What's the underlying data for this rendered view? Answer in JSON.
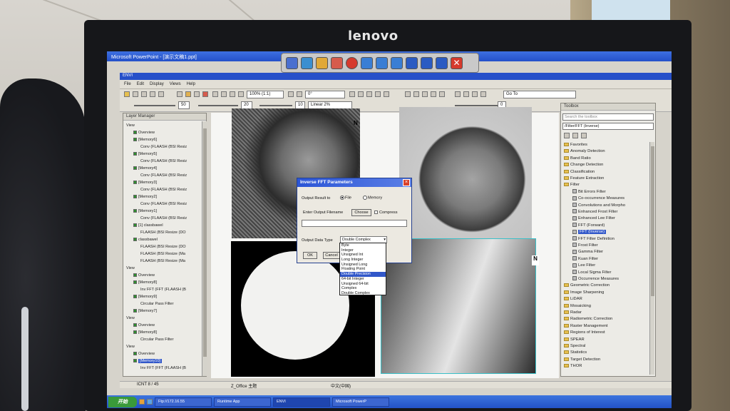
{
  "monitor": {
    "brand": "lenovo"
  },
  "powerpoint": {
    "title": "Microsoft PowerPoint - [演示文稿1.ppt]"
  },
  "envi": {
    "title": "ENVI",
    "menu": [
      "File",
      "Edit",
      "Display",
      "Views",
      "Help"
    ],
    "zoom_value": "100% (1:1)",
    "rotation_value": "0°",
    "stretch_value": "Linear 2%",
    "goto_value": "Go To",
    "brightness_value": "50",
    "contrast_value": "20",
    "sharpen_value": "10",
    "transparency_value": "0"
  },
  "layer_manager": {
    "title": "Layer Manager",
    "rows": [
      {
        "label": "View",
        "depth": 0,
        "box": false
      },
      {
        "label": "Overview",
        "depth": 1,
        "box": true
      },
      {
        "label": "[Memory6]",
        "depth": 1,
        "box": true
      },
      {
        "label": "Conv (FLAASH (BSI Resiz",
        "depth": 2,
        "box": false
      },
      {
        "label": "[Memory5]",
        "depth": 1,
        "box": true
      },
      {
        "label": "Conv (FLAASH (BSI Resiz",
        "depth": 2,
        "box": false
      },
      {
        "label": "[Memory4]",
        "depth": 1,
        "box": true
      },
      {
        "label": "Conv (FLAASH (BSI Resiz",
        "depth": 2,
        "box": false
      },
      {
        "label": "[Memory3]",
        "depth": 1,
        "box": true
      },
      {
        "label": "Conv (FLAASH (BSI Resiz",
        "depth": 2,
        "box": false
      },
      {
        "label": "[Memory2]",
        "depth": 1,
        "box": true
      },
      {
        "label": "Conv (FLAASH (BSI Resiz",
        "depth": 2,
        "box": false
      },
      {
        "label": "[Memory1]",
        "depth": 1,
        "box": true
      },
      {
        "label": "Conv (FLAASH (BSI Resiz",
        "depth": 2,
        "box": false
      },
      {
        "label": "[1] classbawel",
        "depth": 1,
        "box": true
      },
      {
        "label": "FLAASH (BSI Resize (DO",
        "depth": 2,
        "box": false
      },
      {
        "label": "classbawel",
        "depth": 1,
        "box": true
      },
      {
        "label": "FLAASH (BSI Resize (DO",
        "depth": 2,
        "box": false
      },
      {
        "label": "FLAASH (BSI Resize (Ma",
        "depth": 2,
        "box": false
      },
      {
        "label": "FLAASH (BSI Resize (Ma",
        "depth": 2,
        "box": false
      },
      {
        "label": "View",
        "depth": 0,
        "box": false
      },
      {
        "label": "Overview",
        "depth": 1,
        "box": true
      },
      {
        "label": "[Memory8]",
        "depth": 1,
        "box": true
      },
      {
        "label": "Inv FFT (FFT (FLAASH (B",
        "depth": 2,
        "box": false
      },
      {
        "label": "[Memory9]",
        "depth": 1,
        "box": true
      },
      {
        "label": "Circular Pass Filter",
        "depth": 2,
        "box": false
      },
      {
        "label": "[Memory7]",
        "depth": 1,
        "box": true
      },
      {
        "label": "View",
        "depth": 0,
        "box": false
      },
      {
        "label": "Overview",
        "depth": 1,
        "box": true
      },
      {
        "label": "[Memory8]",
        "depth": 1,
        "box": true
      },
      {
        "label": "Circular Pass Filter",
        "depth": 2,
        "box": false
      },
      {
        "label": "View",
        "depth": 0,
        "box": false
      },
      {
        "label": "Overview",
        "depth": 1,
        "box": true
      },
      {
        "label": "[Memory10]",
        "depth": 1,
        "box": true,
        "selected": true
      },
      {
        "label": "Inv FFT (FFT (FLAASH (B",
        "depth": 2,
        "box": false
      }
    ]
  },
  "toolbox": {
    "title": "Toolbox",
    "search_placeholder": "Search the toolbox",
    "path": "/Filter/FFT (Inverse)",
    "rows": [
      {
        "label": "Favorites",
        "type": "folder",
        "depth": 0
      },
      {
        "label": "Anomaly Detection",
        "type": "folder",
        "depth": 0
      },
      {
        "label": "Band Ratio",
        "type": "folder",
        "depth": 0
      },
      {
        "label": "Change Detection",
        "type": "folder",
        "depth": 0
      },
      {
        "label": "Classification",
        "type": "folder",
        "depth": 0
      },
      {
        "label": "Feature Extraction",
        "type": "folder",
        "depth": 0
      },
      {
        "label": "Filter",
        "type": "folder",
        "depth": 0
      },
      {
        "label": "Bit Errors Filter",
        "type": "tool",
        "depth": 1
      },
      {
        "label": "Co-occurrence Measures",
        "type": "tool",
        "depth": 1
      },
      {
        "label": "Convolutions and Morpho",
        "type": "tool",
        "depth": 1
      },
      {
        "label": "Enhanced Frost Filter",
        "type": "tool",
        "depth": 1
      },
      {
        "label": "Enhanced Lee Filter",
        "type": "tool",
        "depth": 1
      },
      {
        "label": "FFT (Forward)",
        "type": "tool",
        "depth": 1
      },
      {
        "label": "FFT (Inverse)",
        "type": "tool",
        "depth": 1,
        "selected": true
      },
      {
        "label": "FFT Filter Definition",
        "type": "tool",
        "depth": 1
      },
      {
        "label": "Frost Filter",
        "type": "tool",
        "depth": 1
      },
      {
        "label": "Gamma Filter",
        "type": "tool",
        "depth": 1
      },
      {
        "label": "Kuan Filter",
        "type": "tool",
        "depth": 1
      },
      {
        "label": "Lee Filter",
        "type": "tool",
        "depth": 1
      },
      {
        "label": "Local Sigma Filter",
        "type": "tool",
        "depth": 1
      },
      {
        "label": "Occurrence Measures",
        "type": "tool",
        "depth": 1
      },
      {
        "label": "Geometric Correction",
        "type": "folder",
        "depth": 0
      },
      {
        "label": "Image Sharpening",
        "type": "folder",
        "depth": 0
      },
      {
        "label": "LiDAR",
        "type": "folder",
        "depth": 0
      },
      {
        "label": "Mosaicking",
        "type": "folder",
        "depth": 0
      },
      {
        "label": "Radar",
        "type": "folder",
        "depth": 0
      },
      {
        "label": "Radiometric Correction",
        "type": "folder",
        "depth": 0
      },
      {
        "label": "Raster Management",
        "type": "folder",
        "depth": 0
      },
      {
        "label": "Regions of Interest",
        "type": "folder",
        "depth": 0
      },
      {
        "label": "SPEAR",
        "type": "folder",
        "depth": 0
      },
      {
        "label": "Spectral",
        "type": "folder",
        "depth": 0
      },
      {
        "label": "Statistics",
        "type": "folder",
        "depth": 0
      },
      {
        "label": "Target Detection",
        "type": "folder",
        "depth": 0
      },
      {
        "label": "THOR",
        "type": "folder",
        "depth": 0
      }
    ]
  },
  "dialog": {
    "title": "Inverse FFT Parameters",
    "output_result_to": "Output Result to",
    "radio_file": "File",
    "radio_memory": "Memory",
    "enter_filename": "Enter Output Filename",
    "choose_button": "Choose",
    "compress_label": "Compress",
    "data_type_label": "Output Data Type",
    "data_type_value": "Double Complex",
    "ok_button": "OK",
    "cancel_button": "Cancel",
    "data_type_options": [
      "Byte",
      "Integer",
      "Unsigned Int",
      "Long Integer",
      "Unsigned Long",
      "Floating Point",
      "Double Precision",
      "64-bit Integer",
      "Unsigned 64-bit",
      "Complex",
      "Double Complex"
    ],
    "highlighted_option": "Double Precision"
  },
  "view_labels": {
    "north_1": "N",
    "north_2": "N"
  },
  "statusbar": {
    "left": "ICNT 8 / 45",
    "middle": "Z_Office 主题",
    "ime": "中文(中国)"
  },
  "taskbar": {
    "start": "开始",
    "tasks": [
      "Ftp://172.16.55",
      "Runtime App",
      "ENVI",
      "Microsoft PowerP"
    ]
  }
}
